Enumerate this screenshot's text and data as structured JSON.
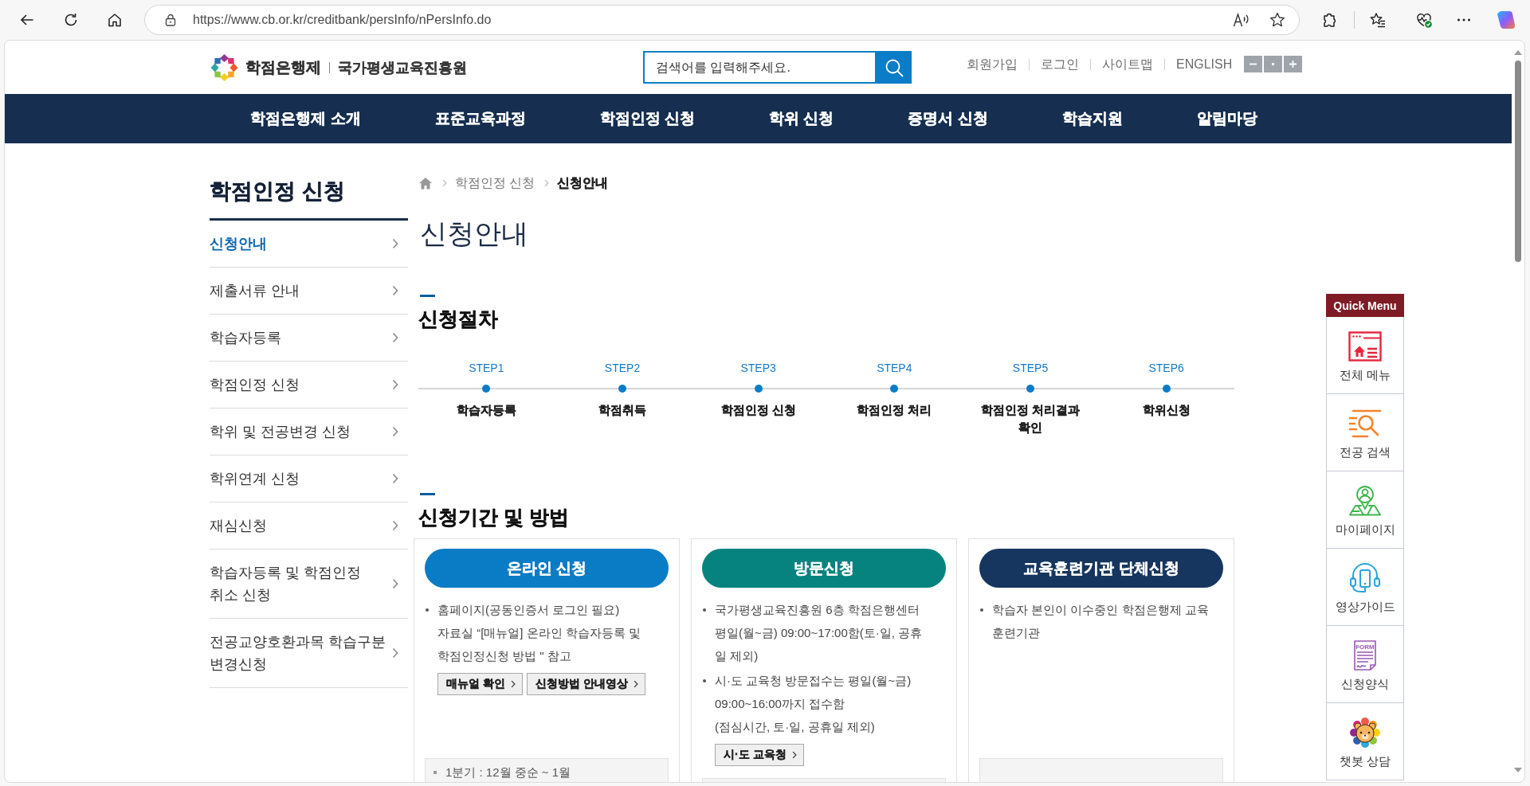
{
  "browser": {
    "url": "https://www.cb.or.kr/creditbank/persInfo/nPersInfo.do"
  },
  "header": {
    "logo": {
      "name": "학점은행제",
      "org": "국가평생교육진흥원"
    },
    "search": {
      "placeholder": "검색어를 입력해주세요."
    },
    "links": [
      "회원가입",
      "로그인",
      "사이트맵",
      "ENGLISH"
    ]
  },
  "nav": [
    "학점은행제 소개",
    "표준교육과정",
    "학점인정 신청",
    "학위 신청",
    "증명서 신청",
    "학습지원",
    "알림마당"
  ],
  "sidebar": {
    "title": "학점인정 신청",
    "items": [
      {
        "label": "신청안내",
        "selected": true
      },
      {
        "label": "제출서류 안내",
        "selected": false
      },
      {
        "label": "학습자등록",
        "selected": false
      },
      {
        "label": "학점인정 신청",
        "selected": false
      },
      {
        "label": "학위 및 전공변경 신청",
        "selected": false
      },
      {
        "label": "학위연계 신청",
        "selected": false
      },
      {
        "label": "재심신청",
        "selected": false
      },
      {
        "label": "학습자등록 및 학점인정\n취소 신청",
        "selected": false
      },
      {
        "label": "전공교양호환과목 학습구분\n변경신청",
        "selected": false
      }
    ]
  },
  "breadcrumb": [
    "학점인정 신청",
    "신청안내"
  ],
  "page_title": "신청안내",
  "process": {
    "heading": "신청절차",
    "steps": [
      {
        "step": "STEP1",
        "name": "학습자등록"
      },
      {
        "step": "STEP2",
        "name": "학점취득"
      },
      {
        "step": "STEP3",
        "name": "학점인정 신청"
      },
      {
        "step": "STEP4",
        "name": "학점인정 처리"
      },
      {
        "step": "STEP5",
        "name": "학점인정 처리결과 확인"
      },
      {
        "step": "STEP6",
        "name": "학위신청"
      }
    ]
  },
  "method": {
    "heading": "신청기간 및 방법",
    "cards": [
      {
        "title": "온라인 신청",
        "color": "#0a7cc5",
        "bullets": [
          "홈페이지(공동인증서 로그인 필요)\n자료실 “[매뉴얼] 온라인 학습자등록 및\n학점인정신청 방법 \" 참고"
        ],
        "buttons": [
          "매뉴얼 확인",
          "신청방법 안내영상"
        ],
        "period": [
          "1분기 : 12월 중순 ~ 1월"
        ]
      },
      {
        "title": "방문신청",
        "color": "#07837f",
        "bullets": [
          "국가평생교육진흥원 6층 학점은행센터\n평일(월~금) 09:00~17:00함(토·일, 공휴\n일 제외)",
          "시·도 교육청 방문접수는 평일(월~금)\n09:00~16:00까지 접수함\n(점심시간, 토·일, 공휴일 제외)"
        ],
        "buttons": [
          "시·도 교육청"
        ]
      },
      {
        "title": "교육훈련기관 단체신청",
        "color": "#16365f",
        "bullets": [
          "학습자 본인이 이수중인 학점은행제 교육\n훈련기관"
        ]
      }
    ]
  },
  "quick_menu": {
    "title": "Quick Menu",
    "items": [
      {
        "label": "전체 메뉴"
      },
      {
        "label": "전공 검색"
      },
      {
        "label": "마이페이지"
      },
      {
        "label": "영상가이드"
      },
      {
        "label": "신청양식",
        "icon_text": "FORM"
      },
      {
        "label": "챗봇 상담"
      }
    ]
  }
}
